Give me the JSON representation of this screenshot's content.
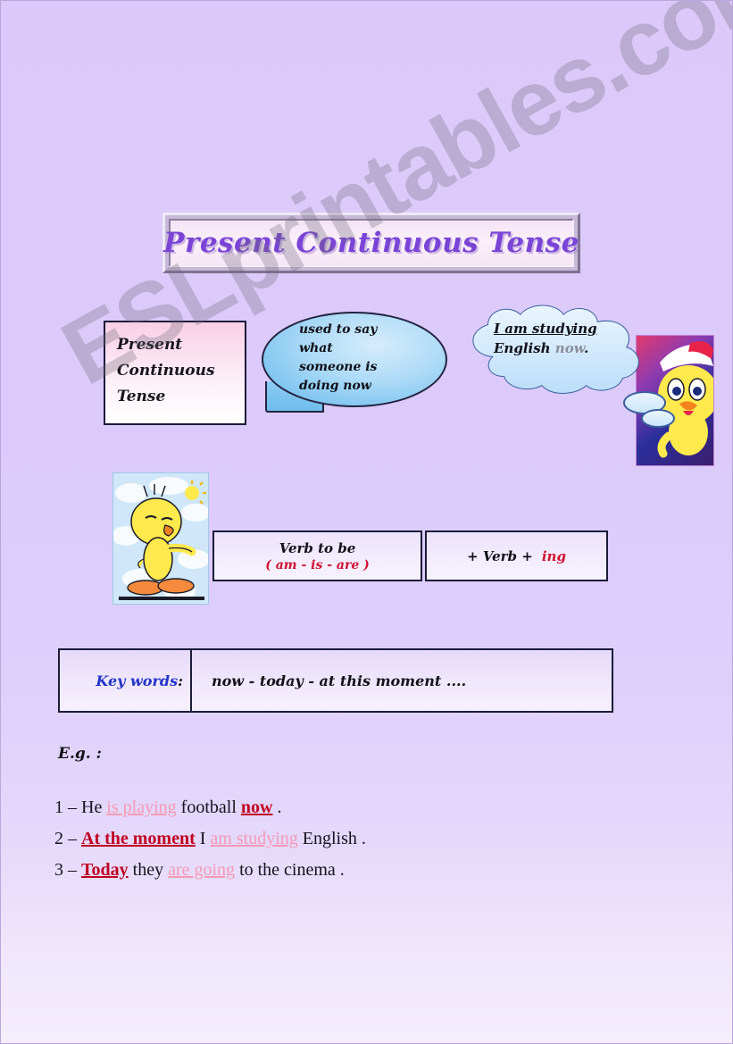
{
  "page": {
    "background_color": "#dcc9fa",
    "watermark": "ESLprintables.com"
  },
  "title_banner": {
    "text": "Present Continuous Tense",
    "text_color": "#7a44d6"
  },
  "definition_box": {
    "lines": [
      "Present",
      "Continuous",
      "Tense"
    ]
  },
  "speech_bubble": {
    "lines": [
      "used to say",
      "what",
      "someone is",
      "doing now"
    ],
    "fill_color": "#79c2f0"
  },
  "thought_cloud": {
    "line1": "I am studying",
    "line2_plain": "English ",
    "line2_gray": "now",
    "line2_end": ".",
    "gray_color": "#8d8d99"
  },
  "images": {
    "tweety_left": "tweety-pointing-image",
    "tweety_right": "tweety-with-hat-image"
  },
  "formula": {
    "left": {
      "line1": "Verb to be",
      "line2": "( am - is - are )",
      "line2_color": "#cf1030"
    },
    "right": {
      "prefix": "+  Verb +",
      "suffix": "ing",
      "suffix_color": "#cf1030"
    }
  },
  "keywords": {
    "label": "Key words",
    "colon": ":",
    "label_color": "#2334c8",
    "value": "now  -  today   -  at this moment ...."
  },
  "examples": {
    "label": "E.g. :",
    "verb_color": "#f59ab4",
    "time_color": "#c00020",
    "items": [
      {
        "number": "1 – ",
        "p1": "He ",
        "verb": "is playing",
        "p2": " football ",
        "time": "now",
        "p3": " ."
      },
      {
        "number": "2 – ",
        "time": "At the moment",
        "p1": " I ",
        "verb": "am studying",
        "p2": " English ."
      },
      {
        "number": "3 – ",
        "time": "Today",
        "p1": " they ",
        "verb": "are going",
        "p2": " to the cinema ."
      }
    ]
  }
}
